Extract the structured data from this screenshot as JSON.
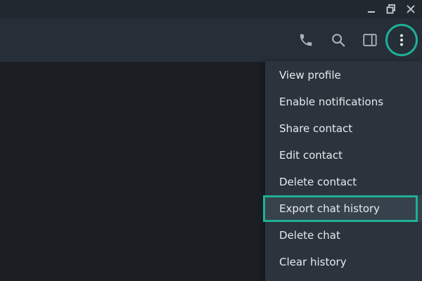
{
  "window_controls": {
    "icons": [
      "minimize-icon",
      "restore-icon",
      "close-icon"
    ]
  },
  "header": {
    "icons": [
      "phone-icon",
      "search-icon",
      "sidebar-toggle-icon",
      "more-vertical-icon"
    ]
  },
  "menu": {
    "items": [
      {
        "label": "View profile"
      },
      {
        "label": "Enable notifications"
      },
      {
        "label": "Share contact"
      },
      {
        "label": "Edit contact"
      },
      {
        "label": "Delete contact"
      },
      {
        "label": "Export chat history"
      },
      {
        "label": "Delete chat"
      },
      {
        "label": "Clear history"
      }
    ],
    "highlighted_index": 5
  },
  "colors": {
    "accent": "#1eb096",
    "menu_background": "#2b333c",
    "header_background": "#262e37",
    "chat_background": "#1b1f24",
    "titlebar_background": "#212830"
  }
}
